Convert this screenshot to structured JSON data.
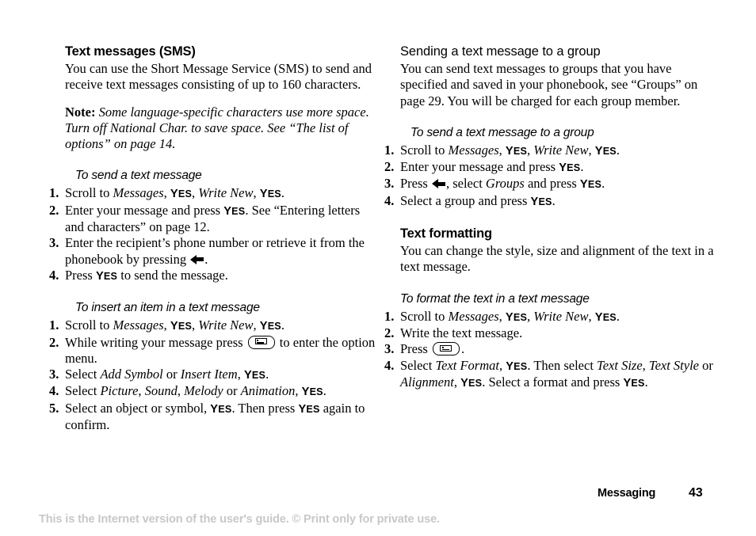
{
  "document": {
    "chapter": "Messaging",
    "page_number": "43",
    "footer_notice": "This is the Internet version of the user's guide. © Print only for private use."
  },
  "left_column": {
    "heading": "Text messages (SMS)",
    "intro": "You can use the Short Message Service (SMS) to send and receive text messages consisting of up to 160 characters.",
    "note_label": "Note:",
    "note_text": "Some language-specific characters use more space. Turn off National Char. to save space. See “The list of options” on page 14.",
    "proc1": {
      "heading": "To send a text message",
      "step1": {
        "a": "Scroll to ",
        "italic1": "Messages",
        "b": ", ",
        "yes1": "YES",
        "c": ", ",
        "italic2": "Write New",
        "d": ", ",
        "yes2": "YES",
        "e": "."
      },
      "step2": {
        "a": "Enter your message and press ",
        "yes1": "YES",
        "b": ". See “Entering letters and characters” on page 12."
      },
      "step3": {
        "a": "Enter the recipient’s phone number or retrieve it from the phonebook by pressing ",
        "b": "."
      },
      "step4": {
        "a": "Press ",
        "yes1": "YES",
        "b": " to send the message."
      }
    },
    "proc2": {
      "heading": "To insert an item in a text message",
      "step1": {
        "a": "Scroll to ",
        "italic1": "Messages",
        "b": ", ",
        "yes1": "YES",
        "c": ", ",
        "italic2": "Write New",
        "d": ", ",
        "yes2": "YES",
        "e": "."
      },
      "step2": {
        "a": "While writing your message press ",
        "b": " to enter the option menu."
      },
      "step3": {
        "a": "Select ",
        "italic1": "Add Symbol",
        "b": " or ",
        "italic2": "Insert Item",
        "c": ", ",
        "yes1": "YES",
        "d": "."
      },
      "step4": {
        "a": "Select ",
        "italic1": "Picture",
        "b": ", ",
        "italic2": "Sound",
        "c": ", ",
        "italic3": "Melody",
        "d": " or ",
        "italic4": "Animation",
        "e": ", ",
        "yes1": "YES",
        "f": "."
      },
      "step5": {
        "a": "Select an object or symbol, ",
        "yes1": "YES",
        "b": ". Then press ",
        "yes2": "YES",
        "c": " again to confirm."
      }
    }
  },
  "right_column": {
    "heading1": "Sending a text message to a group",
    "intro1": "You can send text messages to groups that you have specified and saved in your phonebook, see “Groups” on page 29. You will be charged for each group member.",
    "proc3": {
      "heading": "To send a text message to a group",
      "step1": {
        "a": "Scroll to ",
        "italic1": "Messages",
        "b": ", ",
        "yes1": "YES",
        "c": ", ",
        "italic2": "Write New",
        "d": ", ",
        "yes2": "YES",
        "e": "."
      },
      "step2": {
        "a": "Enter your message and press ",
        "yes1": "YES",
        "b": "."
      },
      "step3": {
        "a": "Press ",
        "b": ", select ",
        "italic1": "Groups",
        "c": " and press ",
        "yes1": "YES",
        "d": "."
      },
      "step4": {
        "a": "Select a group and press ",
        "yes1": "YES",
        "b": "."
      }
    },
    "heading2": "Text formatting",
    "intro2": "You can change the style, size and alignment of the text in a text message.",
    "proc4": {
      "heading": "To format the text in a text message",
      "step1": {
        "a": "Scroll to ",
        "italic1": "Messages",
        "b": ", ",
        "yes1": "YES",
        "c": ", ",
        "italic2": "Write New",
        "d": ", ",
        "yes2": "YES",
        "e": "."
      },
      "step2": {
        "a": "Write the text message."
      },
      "step3": {
        "a": "Press ",
        "b": "."
      },
      "step4": {
        "a": "Select ",
        "italic1": "Text Format",
        "b": ", ",
        "yes1": "YES",
        "c": ". Then select ",
        "italic2": "Text Size",
        "d": ", ",
        "italic3": "Text Style",
        "e": " or ",
        "italic4": "Alignment",
        "f": ", ",
        "yes2": "YES",
        "g": ". Select a format and press ",
        "yes3": "YES",
        "h": "."
      }
    }
  }
}
